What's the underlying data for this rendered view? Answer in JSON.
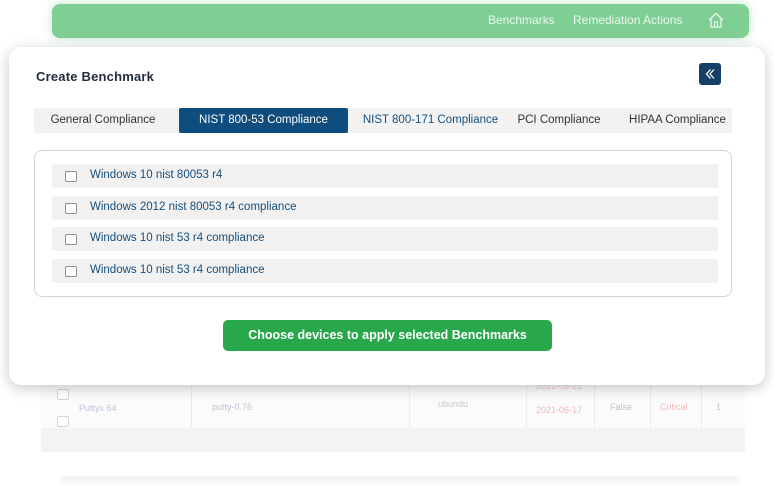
{
  "nav": {
    "links": [
      "Benchmarks",
      "Remediation Actions"
    ],
    "home_icon": "home-icon"
  },
  "background_table": {
    "row": {
      "name": "Puttyx 64",
      "package": "putty-0.76",
      "os": "ubundu",
      "date_top": "2021-06-21",
      "date": "2021-06-17",
      "flag": "False",
      "severity": "Critical",
      "count": "1"
    }
  },
  "modal": {
    "title": "Create Benchmark",
    "back_icon": "chevron-left-icon",
    "tabs": [
      "General Compliance",
      "NIST 800-53 Compliance",
      "NIST 800-171 Compliance",
      "PCI Compliance",
      "HIPAA Compliance"
    ],
    "active_tab": "NIST 800-53 Compliance",
    "benchmarks": [
      "Windows 10 nist 80053 r4",
      "Windows 2012 nist 80053 r4 compliance",
      "Windows 10 nist 53 r4 compliance",
      "Windows 10 nist 53 r4 compliance"
    ],
    "apply_button": "Choose devices to apply selected Benchmarks"
  },
  "colors": {
    "brand_green": "#28a84a",
    "nav_green": "#7fcf95",
    "active_tab": "#0e4d7e",
    "link_blue": "#174f7e",
    "back_button": "#153f66"
  }
}
